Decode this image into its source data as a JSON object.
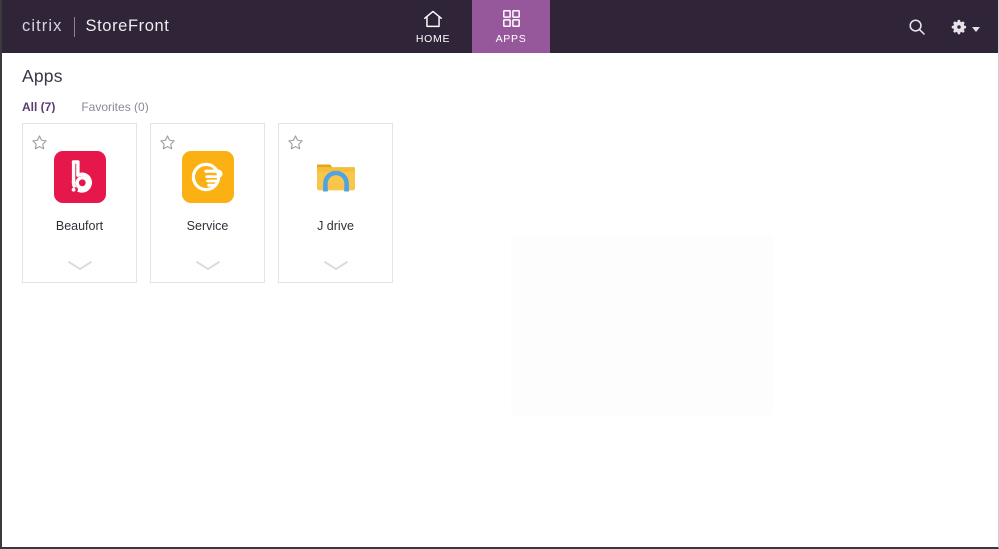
{
  "window": {
    "title": "Citrix StoreFront"
  },
  "header": {
    "brand_primary": "citrix",
    "brand_secondary": "StoreFront",
    "background_color": "#2f2438",
    "active_tab_color": "#96589b",
    "nav_tabs": [
      {
        "label": "HOME",
        "icon": "home-icon",
        "active": false
      },
      {
        "label": "APPS",
        "icon": "grid-icon",
        "active": true
      }
    ],
    "actions": [
      {
        "name": "search-icon",
        "label": "Search"
      },
      {
        "name": "gear-icon",
        "label": "Settings"
      }
    ]
  },
  "main": {
    "page_title": "Apps",
    "filter_tabs": [
      {
        "label": "All (7)",
        "active": true
      },
      {
        "label": "Favorites (0)",
        "active": false
      }
    ],
    "apps": [
      {
        "name": "Beaufort",
        "icon": "beaufort-logo-icon",
        "icon_bg": "#E6174B",
        "favorite": false
      },
      {
        "name": "Service",
        "icon": "pointing-hand-icon",
        "icon_bg": "#FBB013",
        "favorite": false
      },
      {
        "name": "J drive",
        "icon": "network-folder-icon",
        "icon_bg": "#F5C242",
        "favorite": false
      }
    ]
  },
  "colors": {
    "accent_purple": "#6f4f86",
    "tab_active_text": "#5b3b74",
    "tab_inactive_text": "#8e869a",
    "tile_border": "#e3e3e5",
    "page_background": "#ffffff"
  }
}
